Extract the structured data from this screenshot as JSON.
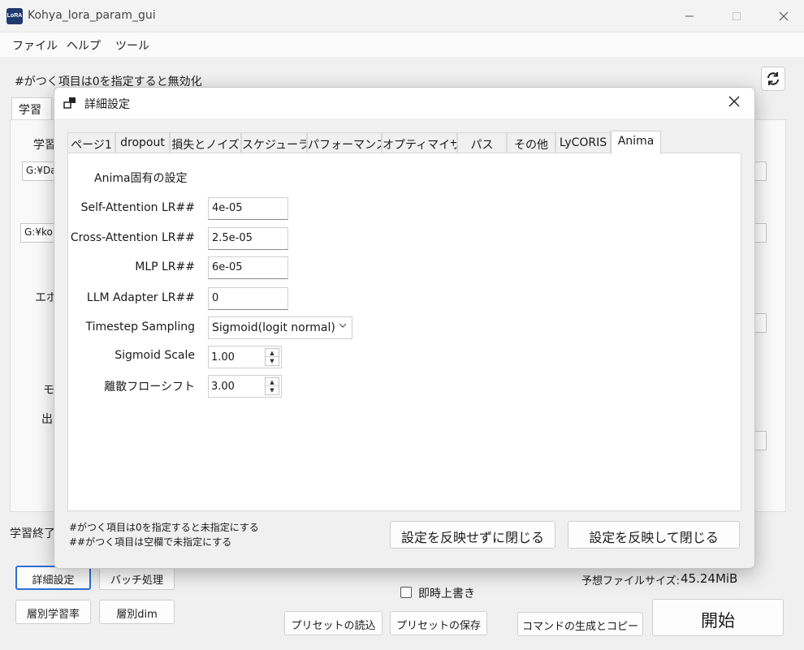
{
  "window": {
    "title": "Kohya_lora_param_gui",
    "icon_text": "LoRA"
  },
  "menu": [
    "ファイル",
    "ヘルプ",
    "ツール"
  ],
  "main": {
    "note": "#がつく項目は0を指定すると無効化",
    "tab_label": "学習",
    "label_learn": "学習",
    "input_1": "G:¥Da",
    "input_2": "G:¥kol",
    "label_epoch": "エポ",
    "label_model": "モ",
    "label_output": "出",
    "label_end": "学習終了",
    "estimate_label": "予想ファイルサイズ:",
    "estimate_value": "45.24MiB",
    "immediate_overwrite": "即時上書き",
    "buttons": {
      "detail_settings": "詳細設定",
      "batch": "バッチ処理",
      "layer_lr": "層別学習率",
      "layer_dim": "層別dim",
      "load_preset": "プリセットの読込",
      "save_preset": "プリセットの保存",
      "generate_command": "コマンドの生成とコピー",
      "start": "開始"
    }
  },
  "dialog": {
    "title": "詳細設定",
    "tabs": [
      "ページ1",
      "dropout",
      "損失とノイズ",
      "スケジューラ",
      "パフォーマンス",
      "オプティマイザ",
      "パス",
      "その他",
      "LyCORIS",
      "Anima"
    ],
    "active_tab": "Anima",
    "section_title": "Anima固有の設定",
    "fields": {
      "self_attention": {
        "label": "Self-Attention LR##",
        "value": "4e-05"
      },
      "cross_attention": {
        "label": "Cross-Attention LR##",
        "value": "2.5e-05"
      },
      "mlp": {
        "label": "MLP LR##",
        "value": "6e-05"
      },
      "llm_adapter": {
        "label": "LLM Adapter LR##",
        "value": "0"
      },
      "timestep_sampling": {
        "label": "Timestep Sampling",
        "value": "Sigmoid(logit normal)"
      },
      "sigmoid_scale": {
        "label": "Sigmoid Scale",
        "value": "1.00"
      },
      "discrete_flow_shift": {
        "label": "離散フローシフト",
        "value": "3.00"
      }
    },
    "note_1": "#がつく項目は0を指定すると未指定にする",
    "note_2": "##がつく項目は空欄で未指定にする",
    "close_without_apply": "設定を反映せずに閉じる",
    "close_with_apply": "設定を反映して閉じる"
  }
}
